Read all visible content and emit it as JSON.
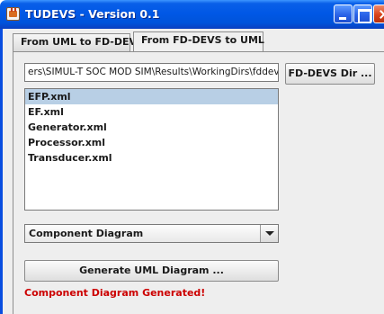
{
  "window": {
    "title": "TUDEVS - Version 0.1"
  },
  "tabs": [
    {
      "label": "From UML to FD-DEVS",
      "selected": false
    },
    {
      "label": "From FD-DEVS to UML",
      "selected": true
    }
  ],
  "directory": {
    "value": "ers\\SIMUL-T SOC MOD SIM\\Results\\WorkingDirs\\fddevs",
    "browse_label": "FD-DEVS Dir ..."
  },
  "files": [
    {
      "name": "EFP.xml",
      "selected": true
    },
    {
      "name": "EF.xml",
      "selected": false
    },
    {
      "name": "Generator.xml",
      "selected": false
    },
    {
      "name": "Processor.xml",
      "selected": false
    },
    {
      "name": "Transducer.xml",
      "selected": false
    }
  ],
  "diagram_type": {
    "selected": "Component Diagram"
  },
  "generate_label": "Generate UML Diagram ...",
  "status_text": "Component Diagram Generated!",
  "colors": {
    "status": "#cc0000",
    "selection": "#b8cfe5",
    "titlebar": "#0058e6"
  }
}
